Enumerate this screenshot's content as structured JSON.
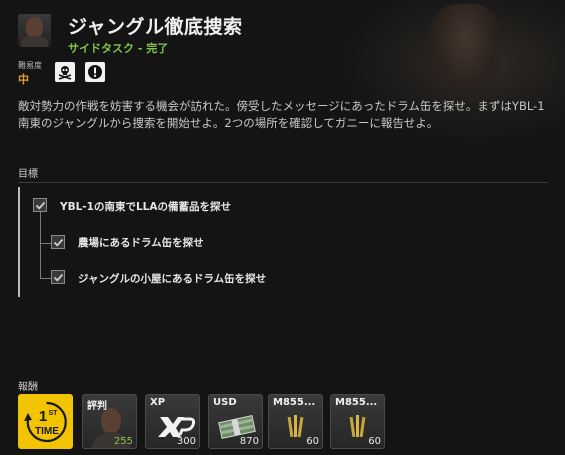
{
  "header": {
    "title": "ジャングル徹底捜索",
    "subtitle": "サイドタスク - 完了"
  },
  "difficulty": {
    "label": "難易度",
    "value": "中",
    "icons": [
      "skull-crossbones-icon",
      "exclamation-icon"
    ]
  },
  "description": "敵対勢力の作戦を妨害する機会が訪れた。傍受したメッセージにあったドラム缶を探せ。まずはYBL-1南東のジャングルから捜索を開始せよ。2つの場所を確認してガニーに報告せよ。",
  "objectives": {
    "label": "目標",
    "items": [
      {
        "text": "YBL-1の南東でLLAの備蓄品を探せ",
        "checked": true
      },
      {
        "text": "農場にあるドラム缶を探せ",
        "checked": true
      },
      {
        "text": "ジャングルの小屋にあるドラム缶を探せ",
        "checked": true
      }
    ]
  },
  "rewards": {
    "label": "報酬",
    "items": [
      {
        "label": "",
        "value": "",
        "icon": "first-time-icon"
      },
      {
        "label": "評判",
        "value": "255",
        "icon": "reputation-portrait-icon"
      },
      {
        "label": "XP",
        "value": "300",
        "icon": "xp-icon"
      },
      {
        "label": "USD",
        "value": "870",
        "icon": "cash-icon"
      },
      {
        "label": "M855...",
        "value": "60",
        "icon": "ammo-icon"
      },
      {
        "label": "M855...",
        "value": "60",
        "icon": "ammo-icon"
      }
    ],
    "first_time_text": [
      "1",
      "ST",
      "TIME"
    ]
  },
  "colors": {
    "completed": "#7fc64a",
    "difficulty": "#e89a2c",
    "first_time_bg": "#f2c300"
  }
}
